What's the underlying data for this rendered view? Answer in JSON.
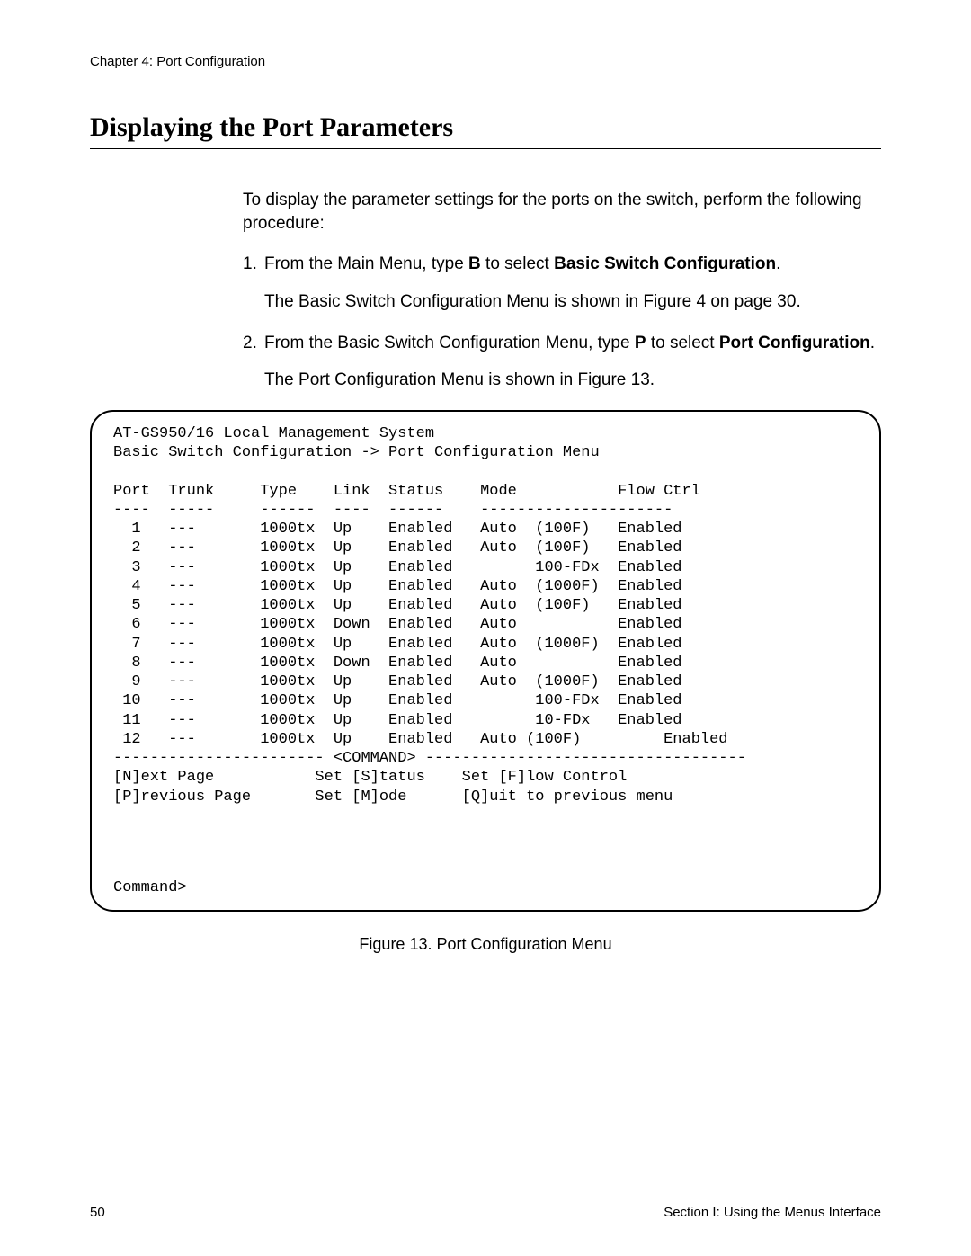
{
  "header": {
    "chapter": "Chapter 4: Port Configuration"
  },
  "title": "Displaying the Port Parameters",
  "intro": "To display the parameter settings for the ports on the switch, perform the following procedure:",
  "steps": {
    "1": {
      "num": "1.",
      "pre": "From the Main Menu, type ",
      "key": "B",
      "mid": " to select ",
      "bold": "Basic Switch Configuration",
      "suffix": ".",
      "sub": "The Basic Switch Configuration Menu is shown in Figure 4 on page 30."
    },
    "2": {
      "num": "2.",
      "pre": "From the Basic Switch Configuration Menu, type ",
      "key": "P",
      "mid": " to select ",
      "bold": "Port Configuration",
      "suffix": ".",
      "sub": "The Port Configuration Menu is shown in Figure 13."
    }
  },
  "terminal": {
    "title_line": "AT-GS950/16 Local Management System",
    "breadcrumb": "Basic Switch Configuration -> Port Configuration Menu",
    "headers": {
      "port": "Port",
      "trunk": "Trunk",
      "type": "Type",
      "link": "Link",
      "status": "Status",
      "mode": "Mode",
      "flow": "Flow Ctrl"
    },
    "sep": {
      "port": "----",
      "trunk": "-----",
      "type": "------",
      "link": "----",
      "status": "------",
      "mode": "---------------------"
    },
    "rows": [
      {
        "port": " 1",
        "trunk": "---",
        "type": "1000tx",
        "link": "Up",
        "status": "Enabled",
        "mode": "Auto  (100F)",
        "modeL": "Auto",
        "modeR": "(100F)",
        "flow": "Enabled"
      },
      {
        "port": " 2",
        "trunk": "---",
        "type": "1000tx",
        "link": "Up",
        "status": "Enabled",
        "mode": "Auto  (100F)",
        "modeL": "Auto",
        "modeR": "(100F)",
        "flow": "Enabled"
      },
      {
        "port": " 3",
        "trunk": "---",
        "type": "1000tx",
        "link": "Up",
        "status": "Enabled",
        "mode": "      100-FDx",
        "modeL": "",
        "modeR": "100-FDx",
        "flow": "Enabled"
      },
      {
        "port": " 4",
        "trunk": "---",
        "type": "1000tx",
        "link": "Up",
        "status": "Enabled",
        "mode": "Auto  (1000F)",
        "modeL": "Auto",
        "modeR": "(1000F)",
        "flow": "Enabled"
      },
      {
        "port": " 5",
        "trunk": "---",
        "type": "1000tx",
        "link": "Up",
        "status": "Enabled",
        "mode": "Auto  (100F)",
        "modeL": "Auto",
        "modeR": "(100F)",
        "flow": "Enabled"
      },
      {
        "port": " 6",
        "trunk": "---",
        "type": "1000tx",
        "link": "Down",
        "status": "Enabled",
        "mode": "Auto",
        "modeL": "Auto",
        "modeR": "",
        "flow": "Enabled"
      },
      {
        "port": " 7",
        "trunk": "---",
        "type": "1000tx",
        "link": "Up",
        "status": "Enabled",
        "mode": "Auto  (1000F)",
        "modeL": "Auto",
        "modeR": "(1000F)",
        "flow": "Enabled"
      },
      {
        "port": " 8",
        "trunk": "---",
        "type": "1000tx",
        "link": "Down",
        "status": "Enabled",
        "mode": "Auto",
        "modeL": "Auto",
        "modeR": "",
        "flow": "Enabled"
      },
      {
        "port": " 9",
        "trunk": "---",
        "type": "1000tx",
        "link": "Up",
        "status": "Enabled",
        "mode": "Auto  (1000F)",
        "modeL": "Auto",
        "modeR": "(1000F)",
        "flow": "Enabled"
      },
      {
        "port": "10",
        "trunk": "---",
        "type": "1000tx",
        "link": "Up",
        "status": "Enabled",
        "mode": "      100-FDx",
        "modeL": "",
        "modeR": "100-FDx",
        "flow": "Enabled"
      },
      {
        "port": "11",
        "trunk": "---",
        "type": "1000tx",
        "link": "Up",
        "status": "Enabled",
        "mode": "       10-FDx",
        "modeL": "",
        "modeR": "10-FDx",
        "flow": "Enabled"
      },
      {
        "port": "12",
        "trunk": "---",
        "type": "1000tx",
        "link": "Up",
        "status": "Enabled",
        "mode": "Auto (100F)",
        "modeL": "Auto (100F)",
        "modeR": "",
        "flow": "Enabled"
      }
    ],
    "command_sep": "----------------------- <COMMAND> -----------------------------------",
    "commands": {
      "r1c1": "[N]ext Page",
      "r1c2": "Set [S]tatus",
      "r1c3": "Set [F]low Control",
      "r2c1": "[P]revious Page",
      "r2c2": "Set [M]ode",
      "r2c3": "[Q]uit to previous menu"
    },
    "prompt": "Command>"
  },
  "figure_caption": "Figure 13. Port Configuration Menu",
  "footer": {
    "pagenum": "50",
    "section": "Section I: Using the Menus Interface"
  }
}
